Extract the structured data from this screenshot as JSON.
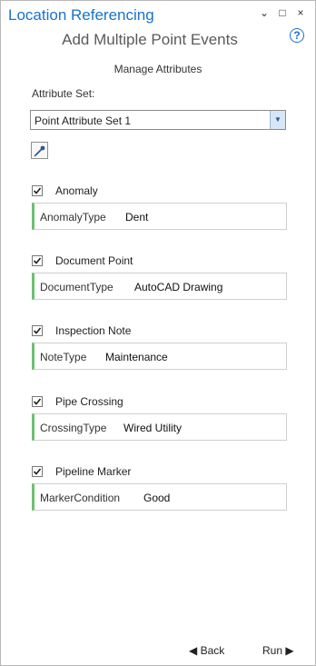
{
  "window": {
    "title": "Location Referencing",
    "controls": [
      "⌄",
      "□",
      "×"
    ]
  },
  "page": {
    "subtitle": "Add Multiple Point Events",
    "help": "?",
    "section_heading": "Manage Attributes"
  },
  "attribute_set": {
    "label": "Attribute Set:",
    "value": "Point Attribute Set 1"
  },
  "attributes": [
    {
      "checked": true,
      "label": "Anomaly",
      "field_name": "AnomalyType",
      "field_value": "Dent"
    },
    {
      "checked": true,
      "label": "Document Point",
      "field_name": "DocumentType",
      "field_value": "AutoCAD Drawing"
    },
    {
      "checked": true,
      "label": "Inspection Note",
      "field_name": "NoteType",
      "field_value": "Maintenance"
    },
    {
      "checked": true,
      "label": "Pipe Crossing",
      "field_name": "CrossingType",
      "field_value": "Wired Utility"
    },
    {
      "checked": true,
      "label": "Pipeline Marker",
      "field_name": "MarkerCondition",
      "field_value": "Good"
    }
  ],
  "footer": {
    "back_label": "◀ Back",
    "run_label": "Run ▶"
  },
  "colors": {
    "accent": "#1a72c9",
    "field_indicator": "#6fbf73"
  }
}
